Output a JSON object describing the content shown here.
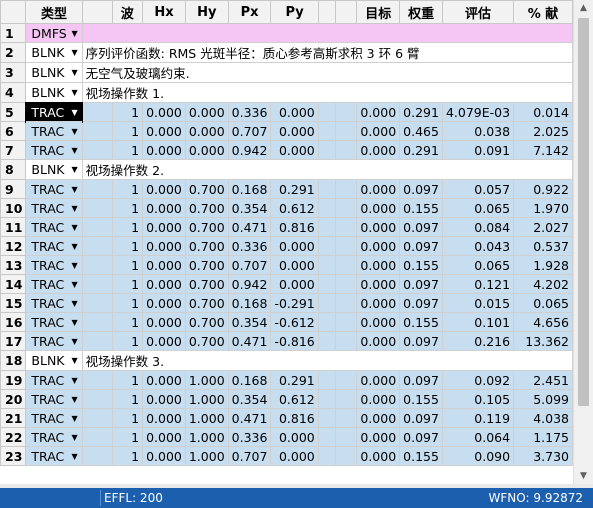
{
  "columns": [
    "",
    "类型",
    "",
    "波",
    "Hx",
    "Hy",
    "Px",
    "Py",
    "",
    "",
    "目标",
    "权重",
    "评估",
    "% 献"
  ],
  "rows": [
    {
      "num": "1",
      "type": "DMFS",
      "kind": "dmfs",
      "comment": ""
    },
    {
      "num": "2",
      "type": "BLNK",
      "kind": "blnk",
      "comment": "序列评价函数: RMS 光斑半径：质心参考高斯求积 3 环 6 臂"
    },
    {
      "num": "3",
      "type": "BLNK",
      "kind": "blnk",
      "comment": "无空气及玻璃约束."
    },
    {
      "num": "4",
      "type": "BLNK",
      "kind": "blnk",
      "comment": "视场操作数 1."
    },
    {
      "num": "5",
      "type": "TRAC",
      "kind": "trac",
      "selected": true,
      "wave": "1",
      "hx": "0.000",
      "hy": "0.000",
      "px": "0.336",
      "py": "0.000",
      "target": "0.000",
      "weight": "0.291",
      "value": "4.079E-03",
      "contrib": "0.014"
    },
    {
      "num": "6",
      "type": "TRAC",
      "kind": "trac",
      "wave": "1",
      "hx": "0.000",
      "hy": "0.000",
      "px": "0.707",
      "py": "0.000",
      "target": "0.000",
      "weight": "0.465",
      "value": "0.038",
      "contrib": "2.025"
    },
    {
      "num": "7",
      "type": "TRAC",
      "kind": "trac",
      "wave": "1",
      "hx": "0.000",
      "hy": "0.000",
      "px": "0.942",
      "py": "0.000",
      "target": "0.000",
      "weight": "0.291",
      "value": "0.091",
      "contrib": "7.142"
    },
    {
      "num": "8",
      "type": "BLNK",
      "kind": "blnk",
      "comment": "视场操作数 2."
    },
    {
      "num": "9",
      "type": "TRAC",
      "kind": "trac",
      "wave": "1",
      "hx": "0.000",
      "hy": "0.700",
      "px": "0.168",
      "py": "0.291",
      "target": "0.000",
      "weight": "0.097",
      "value": "0.057",
      "contrib": "0.922"
    },
    {
      "num": "10",
      "type": "TRAC",
      "kind": "trac",
      "wave": "1",
      "hx": "0.000",
      "hy": "0.700",
      "px": "0.354",
      "py": "0.612",
      "target": "0.000",
      "weight": "0.155",
      "value": "0.065",
      "contrib": "1.970"
    },
    {
      "num": "11",
      "type": "TRAC",
      "kind": "trac",
      "wave": "1",
      "hx": "0.000",
      "hy": "0.700",
      "px": "0.471",
      "py": "0.816",
      "target": "0.000",
      "weight": "0.097",
      "value": "0.084",
      "contrib": "2.027"
    },
    {
      "num": "12",
      "type": "TRAC",
      "kind": "trac",
      "wave": "1",
      "hx": "0.000",
      "hy": "0.700",
      "px": "0.336",
      "py": "0.000",
      "target": "0.000",
      "weight": "0.097",
      "value": "0.043",
      "contrib": "0.537"
    },
    {
      "num": "13",
      "type": "TRAC",
      "kind": "trac",
      "wave": "1",
      "hx": "0.000",
      "hy": "0.700",
      "px": "0.707",
      "py": "0.000",
      "target": "0.000",
      "weight": "0.155",
      "value": "0.065",
      "contrib": "1.928"
    },
    {
      "num": "14",
      "type": "TRAC",
      "kind": "trac",
      "wave": "1",
      "hx": "0.000",
      "hy": "0.700",
      "px": "0.942",
      "py": "0.000",
      "target": "0.000",
      "weight": "0.097",
      "value": "0.121",
      "contrib": "4.202"
    },
    {
      "num": "15",
      "type": "TRAC",
      "kind": "trac",
      "wave": "1",
      "hx": "0.000",
      "hy": "0.700",
      "px": "0.168",
      "py": "-0.291",
      "target": "0.000",
      "weight": "0.097",
      "value": "0.015",
      "contrib": "0.065"
    },
    {
      "num": "16",
      "type": "TRAC",
      "kind": "trac",
      "wave": "1",
      "hx": "0.000",
      "hy": "0.700",
      "px": "0.354",
      "py": "-0.612",
      "target": "0.000",
      "weight": "0.155",
      "value": "0.101",
      "contrib": "4.656"
    },
    {
      "num": "17",
      "type": "TRAC",
      "kind": "trac",
      "wave": "1",
      "hx": "0.000",
      "hy": "0.700",
      "px": "0.471",
      "py": "-0.816",
      "target": "0.000",
      "weight": "0.097",
      "value": "0.216",
      "contrib": "13.362"
    },
    {
      "num": "18",
      "type": "BLNK",
      "kind": "blnk",
      "comment": "视场操作数 3."
    },
    {
      "num": "19",
      "type": "TRAC",
      "kind": "trac",
      "wave": "1",
      "hx": "0.000",
      "hy": "1.000",
      "px": "0.168",
      "py": "0.291",
      "target": "0.000",
      "weight": "0.097",
      "value": "0.092",
      "contrib": "2.451"
    },
    {
      "num": "20",
      "type": "TRAC",
      "kind": "trac",
      "wave": "1",
      "hx": "0.000",
      "hy": "1.000",
      "px": "0.354",
      "py": "0.612",
      "target": "0.000",
      "weight": "0.155",
      "value": "0.105",
      "contrib": "5.099"
    },
    {
      "num": "21",
      "type": "TRAC",
      "kind": "trac",
      "wave": "1",
      "hx": "0.000",
      "hy": "1.000",
      "px": "0.471",
      "py": "0.816",
      "target": "0.000",
      "weight": "0.097",
      "value": "0.119",
      "contrib": "4.038"
    },
    {
      "num": "22",
      "type": "TRAC",
      "kind": "trac",
      "wave": "1",
      "hx": "0.000",
      "hy": "1.000",
      "px": "0.336",
      "py": "0.000",
      "target": "0.000",
      "weight": "0.097",
      "value": "0.064",
      "contrib": "1.175"
    },
    {
      "num": "23",
      "type": "TRAC",
      "kind": "trac",
      "wave": "1",
      "hx": "0.000",
      "hy": "1.000",
      "px": "0.707",
      "py": "0.000",
      "target": "0.000",
      "weight": "0.155",
      "value": "0.090",
      "contrib": "3.730"
    }
  ],
  "status": {
    "effl": "EFFL: 200",
    "wfno": "WFNO: 9.92872"
  },
  "icons": {
    "dropdown": "chevron-down-icon",
    "scroll_up": "scroll-up-arrow-icon",
    "scroll_down": "scroll-down-arrow-icon"
  },
  "colors": {
    "trac_row": "#c7def1",
    "dmfs_row": "#f5c6f3",
    "statusbar": "#1c5fae"
  }
}
